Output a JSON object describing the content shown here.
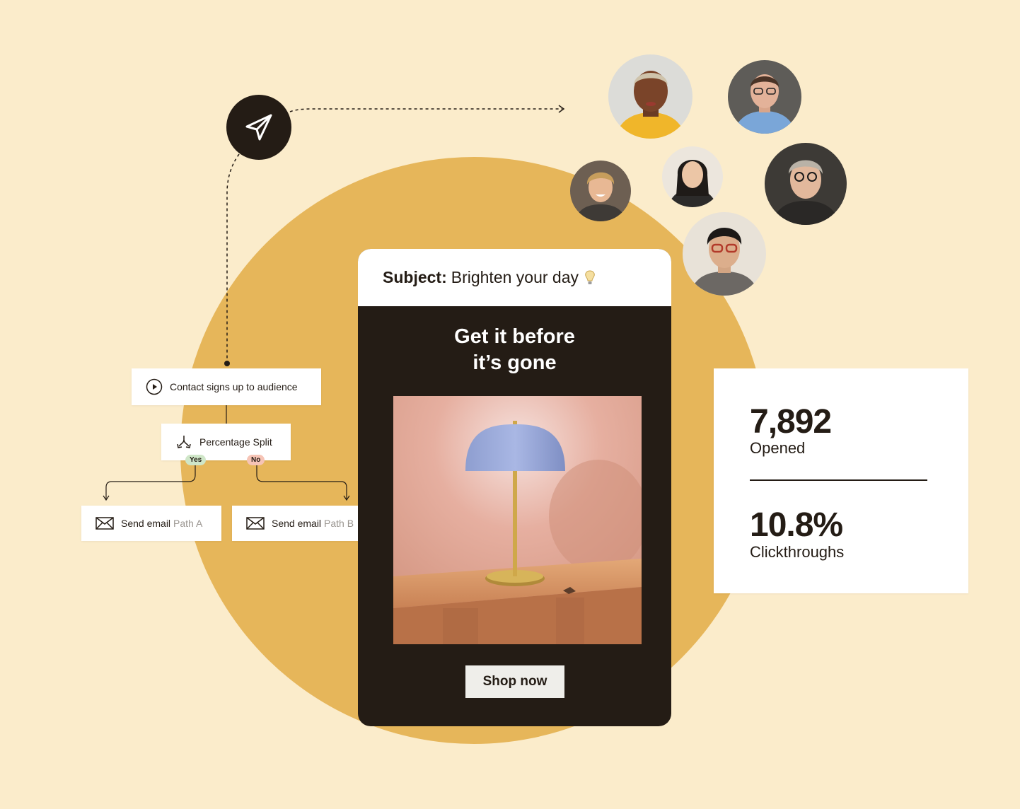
{
  "workflow": {
    "trigger_label": "Contact signs up to audience",
    "split_label": "Percentage Split",
    "yes_label": "Yes",
    "no_label": "No",
    "email_a": {
      "label": "Send email",
      "path": "Path A"
    },
    "email_b": {
      "label": "Send email",
      "path": "Path B"
    }
  },
  "email": {
    "subject_prefix": "Subject:",
    "subject_text": "Brighten your day",
    "headline_line1": "Get it before",
    "headline_line2": "it’s gone",
    "cta_label": "Shop now"
  },
  "stats": {
    "opened_value": "7,892",
    "opened_label": "Opened",
    "clickthrough_value": "10.8%",
    "clickthrough_label": "Clickthroughs"
  },
  "colors": {
    "background": "#fbeccb",
    "circle": "#e6b65a",
    "dark": "#241c15",
    "white": "#ffffff"
  },
  "icons": [
    "paper-plane-icon",
    "play-circle-icon",
    "split-arrows-icon",
    "envelope-icon",
    "lightbulb-icon"
  ]
}
